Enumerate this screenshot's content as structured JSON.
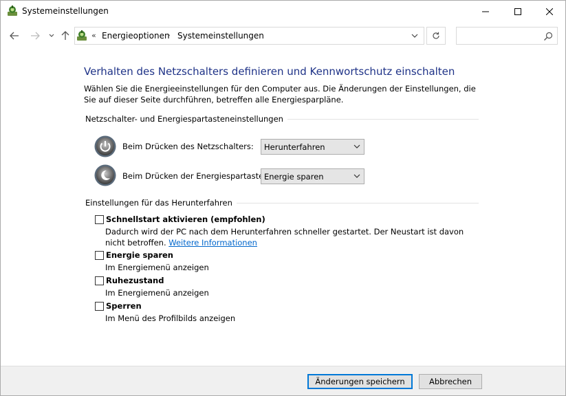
{
  "window": {
    "title": "Systemeinstellungen",
    "icon": "control-panel-power-icon",
    "controls": [
      "minimize-icon",
      "maximize-icon",
      "close-icon"
    ]
  },
  "navigation": {
    "back_icon": "arrow-left-icon",
    "forward_icon": "arrow-right-icon",
    "recent_icon": "chevron-down-icon",
    "up_icon": "arrow-up-icon",
    "address": {
      "overflow": "«",
      "breadcrumbs": [
        "Energieoptionen",
        "Systemeinstellungen"
      ],
      "separator": "›"
    },
    "refresh_icon": "refresh-icon",
    "search": {
      "placeholder": "",
      "icon": "search-icon"
    }
  },
  "main": {
    "title": "Verhalten des Netzschalters definieren und Kennwortschutz einschalten",
    "intro": "Wählen Sie die Energieeinstellungen für den Computer aus. Die Änderungen der Einstellungen, die Sie auf dieser Seite durchführen, betreffen alle Energiesparpläne.",
    "button_group": {
      "heading": "Netzschalter- und Energiespartasteneinstellungen",
      "settings": [
        {
          "icon": "power-button-icon",
          "label": "Beim Drücken des Netzschalters:",
          "selected": "Herunterfahren"
        },
        {
          "icon": "sleep-button-icon",
          "label": "Beim Drücken der Energiespartaste:",
          "selected": "Energie sparen"
        }
      ]
    },
    "shutdown_group": {
      "heading": "Einstellungen für das Herunterfahren",
      "options": [
        {
          "title": "Schnellstart aktivieren (empfohlen)",
          "description": "Dadurch wird der PC nach dem Herunterfahren schneller gestartet. Der Neustart ist davon nicht betroffen.",
          "link": "Weitere Informationen",
          "checked": false
        },
        {
          "title": "Energie sparen",
          "description": "Im Energiemenü anzeigen",
          "checked": false
        },
        {
          "title": "Ruhezustand",
          "description": "Im Energiemenü anzeigen",
          "checked": false
        },
        {
          "title": "Sperren",
          "description": "Im Menü des Profilbilds anzeigen",
          "checked": false
        }
      ]
    }
  },
  "footer": {
    "save_label": "Änderungen speichern",
    "cancel_label": "Abbrechen"
  },
  "colors": {
    "title_blue": "#1e3287",
    "link_blue": "#0066cc",
    "default_button_border": "#0078d7",
    "footer_bg": "#f0f0f0"
  }
}
